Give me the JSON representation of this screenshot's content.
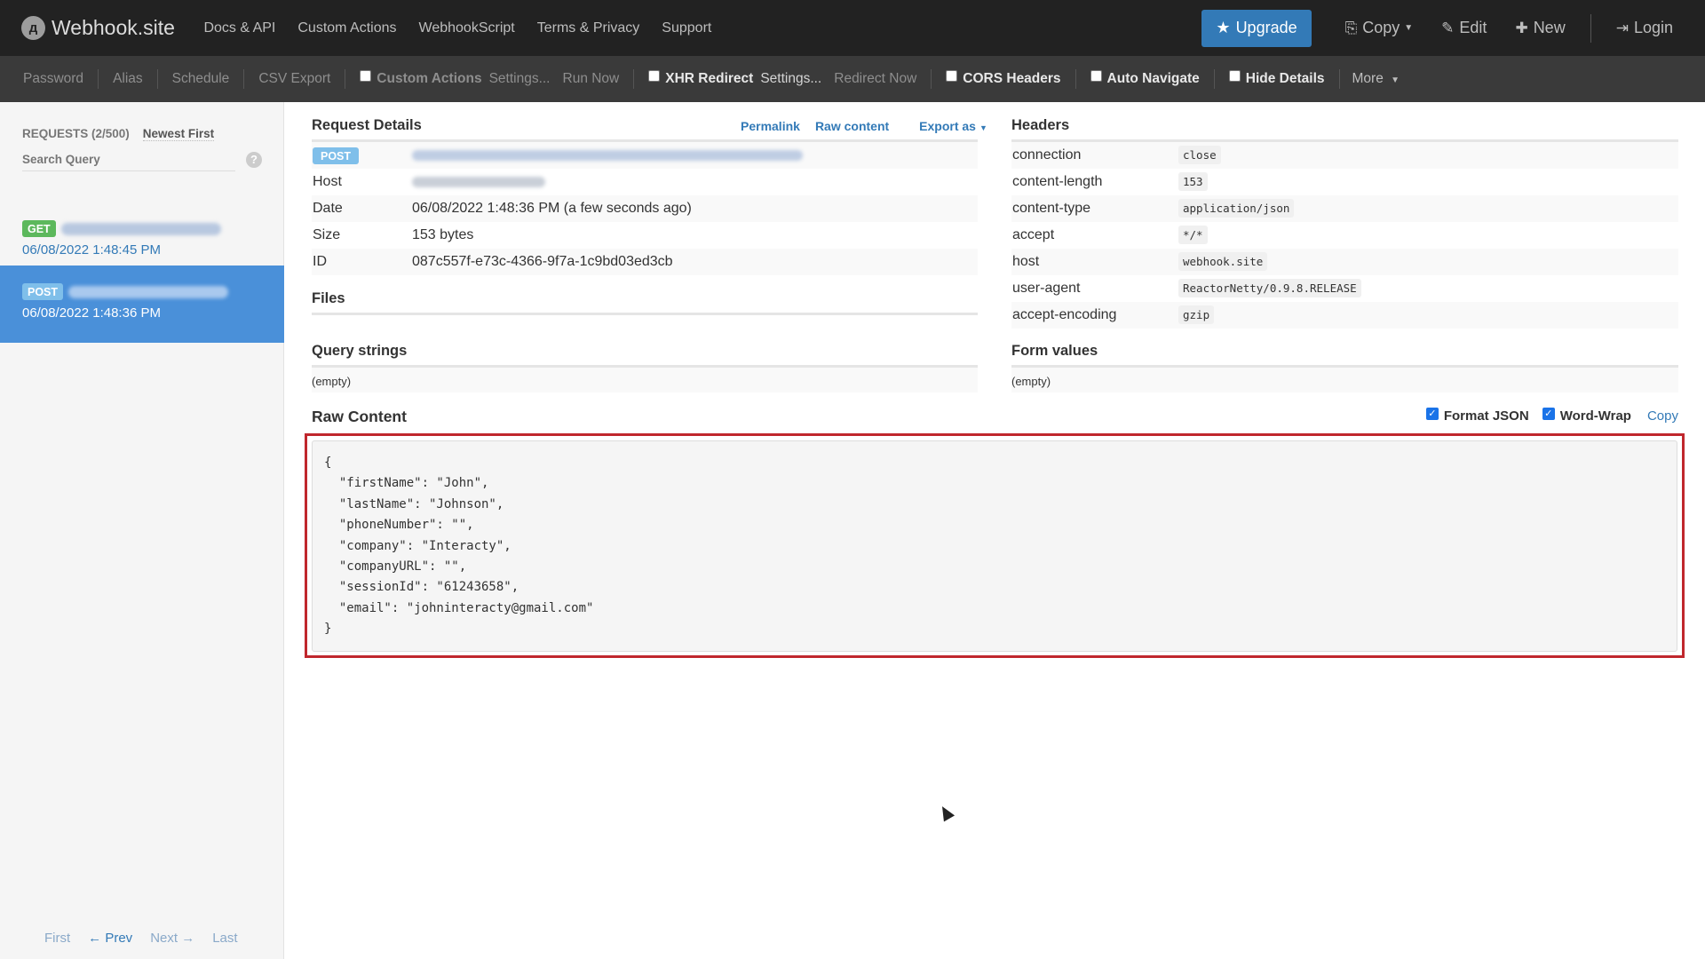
{
  "brand": {
    "logo_text": "д",
    "name": "Webhook.site"
  },
  "nav": {
    "links": [
      "Docs & API",
      "Custom Actions",
      "WebhookScript",
      "Terms & Privacy",
      "Support"
    ],
    "upgrade": "Upgrade",
    "copy": "Copy",
    "edit": "Edit",
    "new": "New",
    "login": "Login"
  },
  "toolbar": {
    "password": "Password",
    "alias": "Alias",
    "schedule": "Schedule",
    "csv_export": "CSV Export",
    "custom_actions": "Custom Actions",
    "custom_actions_settings": "Settings...",
    "run_now": "Run Now",
    "xhr_redirect": "XHR Redirect",
    "xhr_settings": "Settings...",
    "redirect_now": "Redirect Now",
    "cors_headers": "CORS Headers",
    "auto_navigate": "Auto Navigate",
    "hide_details": "Hide Details",
    "more": "More"
  },
  "sidebar": {
    "requests_label": "REQUESTS (2/500)",
    "sort": "Newest First",
    "search_placeholder": "Search Query",
    "help": "?",
    "requests": [
      {
        "method": "GET",
        "time": "06/08/2022 1:48:45 PM"
      },
      {
        "method": "POST",
        "time": "06/08/2022 1:48:36 PM"
      }
    ],
    "pager": {
      "first": "First",
      "prev": "← Prev",
      "next": "Next →",
      "last": "Last"
    }
  },
  "request_details": {
    "title": "Request Details",
    "permalink": "Permalink",
    "raw_content_link": "Raw content",
    "export_as": "Export as",
    "method": "POST",
    "rows": [
      {
        "key": "Host"
      },
      {
        "key": "Date",
        "value": "06/08/2022 1:48:36 PM (a few seconds ago)"
      },
      {
        "key": "Size",
        "value": "153 bytes"
      },
      {
        "key": "ID",
        "value": "087c557f-e73c-4366-9f7a-1c9bd03ed3cb"
      }
    ]
  },
  "headers": {
    "title": "Headers",
    "rows": [
      {
        "key": "connection",
        "value": "close"
      },
      {
        "key": "content-length",
        "value": "153"
      },
      {
        "key": "content-type",
        "value": "application/json"
      },
      {
        "key": "accept",
        "value": "*/*"
      },
      {
        "key": "host",
        "value": "webhook.site"
      },
      {
        "key": "user-agent",
        "value": "ReactorNetty/0.9.8.RELEASE"
      },
      {
        "key": "accept-encoding",
        "value": "gzip"
      }
    ]
  },
  "files": {
    "title": "Files"
  },
  "query_strings": {
    "title": "Query strings",
    "empty": "(empty)"
  },
  "form_values": {
    "title": "Form values",
    "empty": "(empty)"
  },
  "raw_content": {
    "title": "Raw Content",
    "format_json": "Format JSON",
    "word_wrap": "Word-Wrap",
    "copy": "Copy",
    "body": "{\n  \"firstName\": \"John\",\n  \"lastName\": \"Johnson\",\n  \"phoneNumber\": \"\",\n  \"company\": \"Interacty\",\n  \"companyURL\": \"\",\n  \"sessionId\": \"61243658\",\n  \"email\": \"johninteracty@gmail.com\"\n}"
  },
  "colors": {
    "accent": "#337ab7",
    "highlight_border": "#c0272d",
    "selected_row": "#4a90d9",
    "get_badge": "#5cb85c"
  }
}
